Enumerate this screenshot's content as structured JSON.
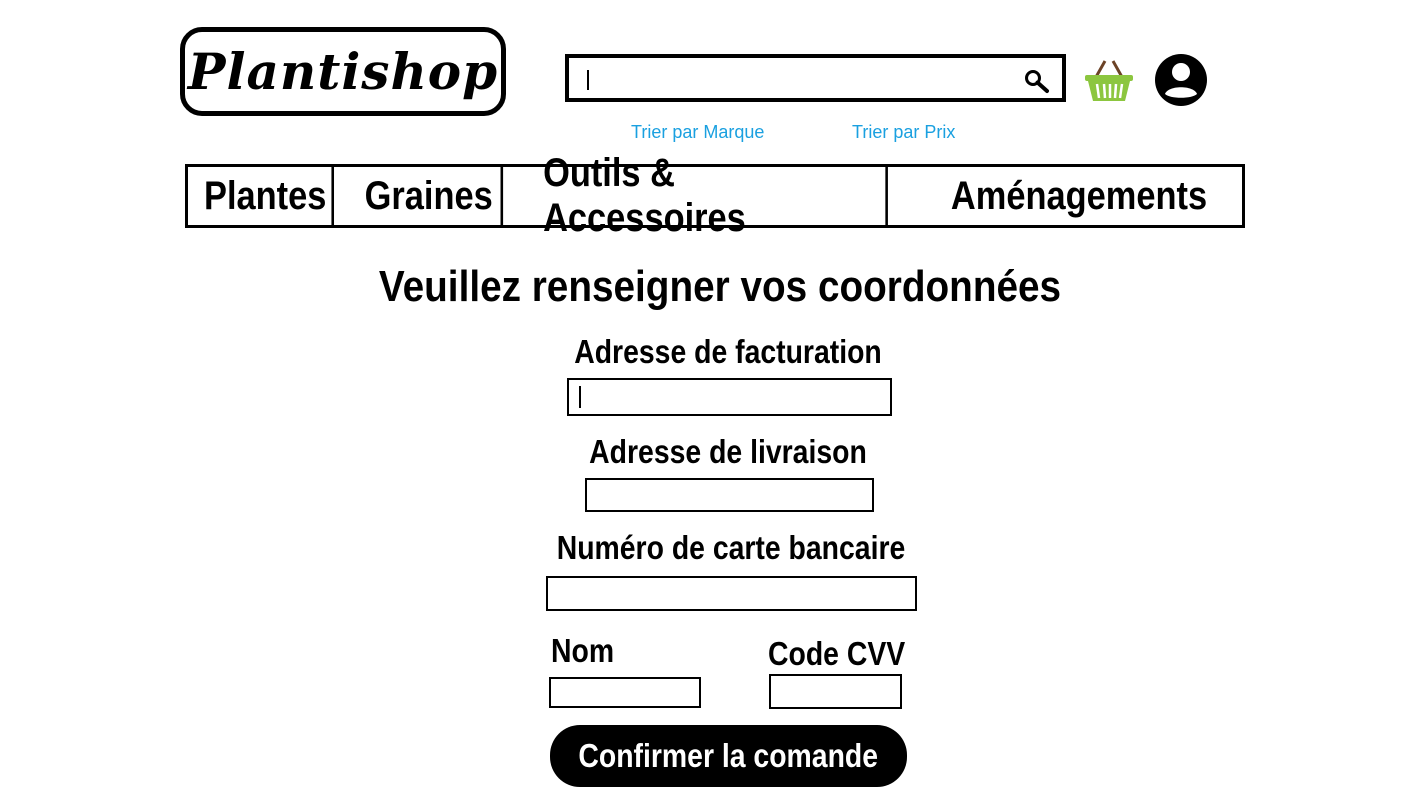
{
  "header": {
    "logo_text": "Plantishop",
    "search": {
      "value": "",
      "placeholder": ""
    },
    "search_icon": "search-icon",
    "cart_icon": "basket-icon",
    "account_icon": "user-icon",
    "sort_links": [
      "Trier par Marque",
      "Trier par Prix"
    ]
  },
  "nav": {
    "items": [
      "Plantes",
      "Graines",
      "Outils & Accessoires",
      "Aménagements"
    ]
  },
  "form": {
    "title": "Veuillez renseigner vos coordonnées",
    "billing_label": "Adresse de facturation",
    "shipping_label": "Adresse de livraison",
    "card_label": "Numéro de carte bancaire",
    "name_label": "Nom",
    "cvv_label": "Code CVV",
    "confirm_label": "Confirmer la comande"
  },
  "colors": {
    "link": "#1aa0e0",
    "basket_green": "#8cc63f",
    "basket_handle": "#6b4226"
  }
}
